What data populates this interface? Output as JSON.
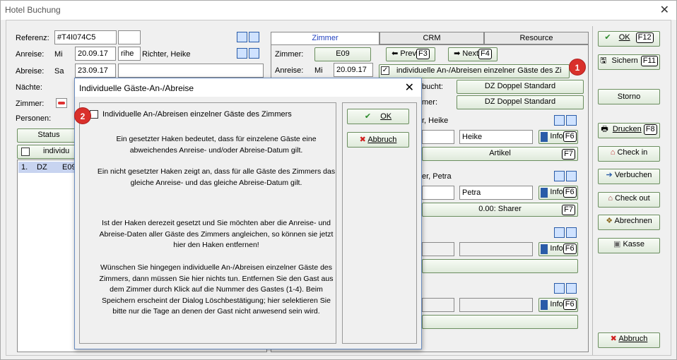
{
  "window": {
    "title": "Hotel Buchung"
  },
  "left": {
    "referenz_label": "Referenz:",
    "referenz_value": "#T4I074C5",
    "anreise_label": "Anreise:",
    "anreise_day": "Mi",
    "anreise_date": "20.09.17",
    "anreise_extra": "rihe",
    "guest_name": "Richter, Heike",
    "abreise_label": "Abreise:",
    "abreise_day": "Sa",
    "abreise_date": "23.09.17",
    "naechte_label": "Nächte:",
    "zimmer_label": "Zimmer:",
    "personen_label": "Personen:",
    "status_label": "Status",
    "individu_label": "individu",
    "list_row": {
      "num": "1.",
      "type": "DZ",
      "room": "E09"
    }
  },
  "tabs": [
    "Zimmer",
    "CRM",
    "Resource"
  ],
  "room": {
    "zimmer_label": "Zimmer:",
    "zimmer_value": "E09",
    "anreise_label": "Anreise:",
    "anreise_day": "Mi",
    "anreise_date": "20.09.17",
    "prev_label": "Prev",
    "prev_key": "F3",
    "next_label": "Next",
    "next_key": "F4",
    "indiv_label": "individuelle An-/Abreisen einzelner Gäste des Zi",
    "gebucht_label": "bucht:",
    "gebucht_value": "DZ Doppel Standard",
    "zimmer2_label": "mer:",
    "zimmer2_value": "DZ Doppel Standard",
    "guest1_header": "r, Heike",
    "guest1_first": "Heike",
    "info_label": "Info",
    "info_key": "F6",
    "artikel_label": "Artikel",
    "artikel_key": "F7",
    "guest2_header": "er, Petra",
    "guest2_first": "Petra",
    "sharer_label": "0.00: Sharer",
    "sharer_key": "F7"
  },
  "side": {
    "ok_label": "OK",
    "ok_key": "F12",
    "sichern_label": "Sichern",
    "sichern_key": "F11",
    "storno_label": "Storno",
    "drucken_label": "Drucken",
    "drucken_key": "F8",
    "checkin_label": "Check in",
    "verbuchen_label": "Verbuchen",
    "checkout_label": "Check out",
    "abrechnen_label": "Abrechnen",
    "kasse_label": "Kasse",
    "abbruch_label": "Abbruch"
  },
  "dialog": {
    "title": "Individuelle Gäste-An-/Abreise",
    "checkbox_label": "Individuelle An-/Abreisen einzelner Gäste des Zimmers",
    "ok_label": "OK",
    "abbruch_label": "Abbruch",
    "p1": "Ein gesetzter Haken bedeutet, dass für einzelene Gäste eine abweichendes Anreise- und/oder Abreise-Datum gilt.",
    "p2": "Ein nicht gesetzter Haken zeigt an, dass für alle Gäste des Zimmers das gleiche Anreise- und das gleiche Abreise-Datum gilt.",
    "p3": "Ist der Haken derezeit gesetzt und Sie möchten aber die Anreise- und Abreise-Daten aller Gäste des Zimmers angleichen, so können sie jetzt hier den Haken entfernen!",
    "p4": "Wünschen Sie hingegen individuelle An-/Abreisen einzelner Gäste des Zimmers, dann müssen Sie hier nichts tun. Entfernen Sie den Gast aus dem Zimmer durch Klick auf die Nummer des Gastes (1-4). Beim Speichern erscheint der Dialog Löschbestätigung; hier selektieren Sie bitte nur die Tage an denen der Gast nicht anwesend sein wird."
  },
  "badges": {
    "b1": "1",
    "b2": "2"
  },
  "colors": {
    "accent": "#2040c0",
    "badge": "#d9302b",
    "list_selection": "#c8d4f0"
  }
}
